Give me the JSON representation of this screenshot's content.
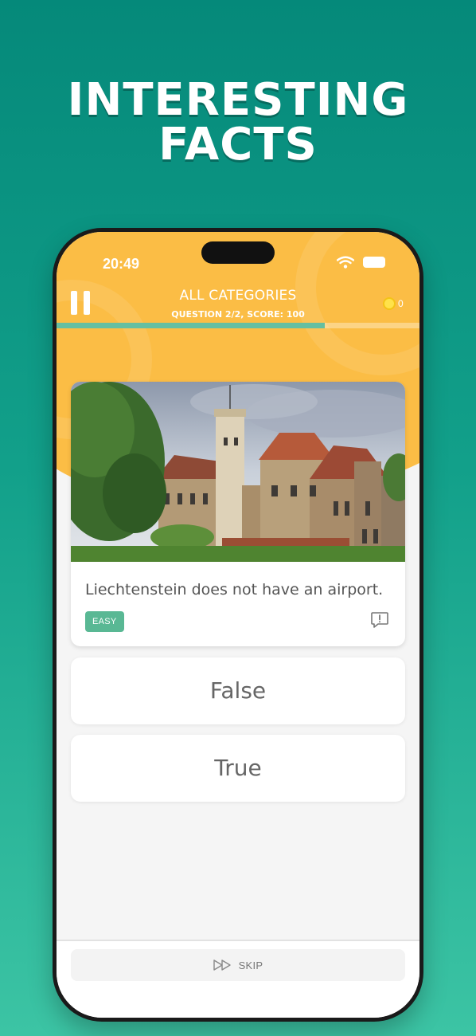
{
  "headline": {
    "line1": "INTERESTING",
    "line2": "FACTS"
  },
  "status_bar": {
    "time": "20:49"
  },
  "header": {
    "title": "ALL CATEGORIES",
    "subtitle": "QUESTION 2/2, SCORE: 100",
    "coins": "0",
    "progress_fraction": 0.74
  },
  "question": {
    "text": "Liechtenstein does not have an airport.",
    "difficulty": "EASY",
    "image": "castle-photo"
  },
  "answers": [
    {
      "label": "False"
    },
    {
      "label": "True"
    }
  ],
  "skip": {
    "label": "SKIP"
  },
  "colors": {
    "background": "#0b8f7e",
    "header_yellow": "#fbbd45",
    "progress": "#66bfa1",
    "badge": "#59b894"
  },
  "icons": [
    "pause-icon",
    "coin-icon",
    "wifi-icon",
    "battery-icon",
    "report-icon",
    "fast-forward-icon"
  ]
}
